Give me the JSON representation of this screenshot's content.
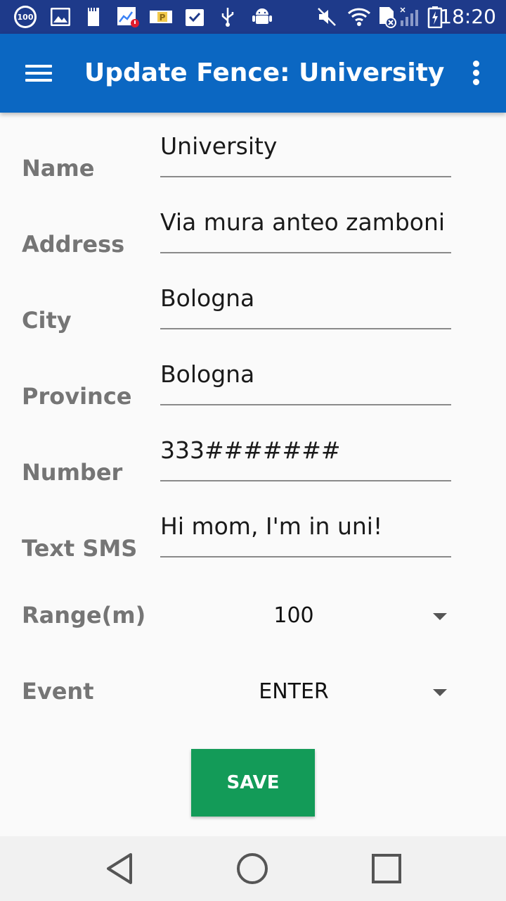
{
  "status_bar": {
    "time": "18:20",
    "notif_badge": "100",
    "icons": [
      "hundred-circle-icon",
      "image-icon",
      "sd-100-icon",
      "chart-alert-icon",
      "parking-icon",
      "clipboard-check-icon",
      "usb-icon",
      "android-icon",
      "mute-icon",
      "wifi-icon",
      "sim-icon",
      "signal-icon",
      "battery-charging-icon"
    ],
    "small_100": "100",
    "parking_letter": "P"
  },
  "app_bar": {
    "title": "Update Fence: University",
    "menu_icon": "hamburger-menu-icon",
    "overflow_icon": "more-vertical-icon",
    "color": "#0b67c2"
  },
  "form": {
    "name": {
      "label": "Name",
      "value": "University"
    },
    "address": {
      "label": "Address",
      "value": "Via mura anteo zamboni"
    },
    "city": {
      "label": "City",
      "value": "Bologna"
    },
    "province": {
      "label": "Province",
      "value": "Bologna"
    },
    "number": {
      "label": "Number",
      "value": "333#######"
    },
    "text_sms": {
      "label": "Text SMS",
      "value": "Hi mom, I'm in uni!"
    },
    "range": {
      "label": "Range(m)",
      "value": "100"
    },
    "event": {
      "label": "Event",
      "value": "ENTER"
    }
  },
  "save_button": {
    "label": "SAVE",
    "color": "#139b58"
  },
  "nav_bar": {
    "icons": [
      "back-icon",
      "home-icon",
      "recents-icon"
    ]
  }
}
